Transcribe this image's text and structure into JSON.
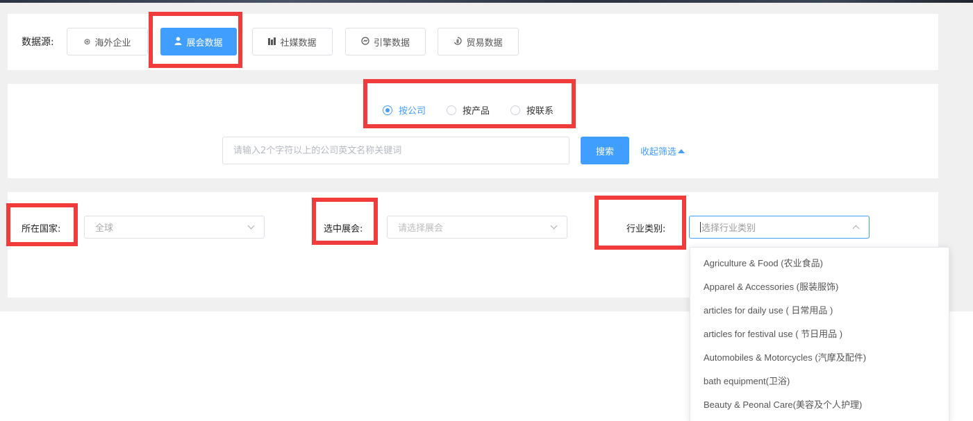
{
  "data_source": {
    "label": "数据源:",
    "buttons": [
      {
        "icon": "aperture-icon",
        "glyph": "⊛",
        "label": "海外企业",
        "active": false
      },
      {
        "icon": "user-icon",
        "glyph": "👤",
        "label": "展会数据",
        "active": true
      },
      {
        "icon": "bar-chart-icon",
        "glyph": "▥",
        "label": "社媒数据",
        "active": false
      },
      {
        "icon": "gauge-icon",
        "glyph": "◔",
        "label": "引擎数据",
        "active": false
      },
      {
        "icon": "coin-icon",
        "glyph": "♻",
        "label": "贸易数据",
        "active": false
      }
    ]
  },
  "search_mode": {
    "options": [
      {
        "label": "按公司",
        "checked": true
      },
      {
        "label": "按产品",
        "checked": false
      },
      {
        "label": "按联系",
        "checked": false
      }
    ]
  },
  "search": {
    "placeholder": "请输入2个字符以上的公司英文名称关键词",
    "value": "",
    "button_label": "搜索",
    "collapse_label": "收起筛选"
  },
  "filters": {
    "country": {
      "label": "所在国家:",
      "value": "全球"
    },
    "exhibition": {
      "label": "选中展会:",
      "placeholder": "请选择展会"
    },
    "industry": {
      "label": "行业类别:",
      "placeholder": "选择行业类别"
    }
  },
  "industry_options": [
    "Agriculture & Food (农业食品)",
    "Apparel & Accessories (服装服饰)",
    "articles for daily use ( 日常用品 )",
    "articles for festival use ( 节日用品 )",
    "Automobiles & Motorcycles (汽摩及配件)",
    "bath equipment(卫浴)",
    "Beauty & Peonal Care(美容及个人护理)"
  ],
  "colors": {
    "accent": "#409eff",
    "highlight": "#f13c3c",
    "page_bg": "#f0f0f0"
  }
}
